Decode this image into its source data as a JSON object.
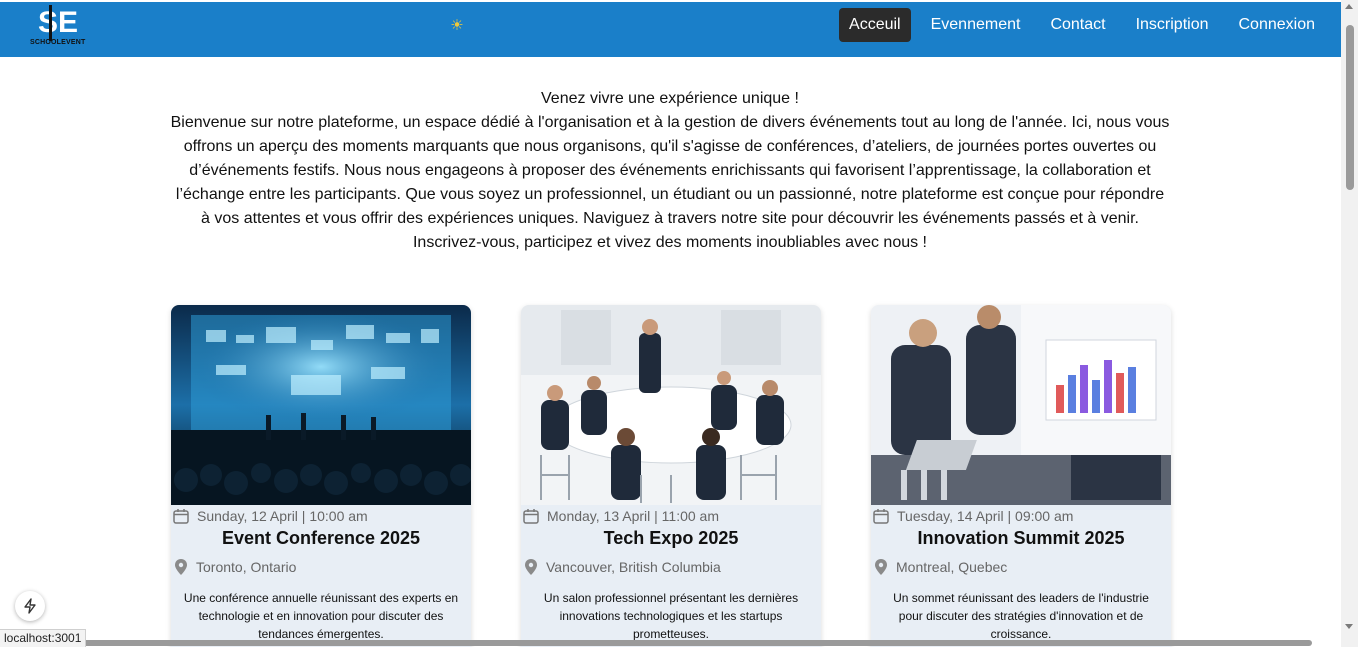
{
  "header": {
    "logo": {
      "initials": "SE",
      "name": "SCHOOLEVENT"
    },
    "theme_icon": "sun-icon",
    "nav": [
      {
        "label": "Acceuil",
        "active": true
      },
      {
        "label": "Evennement",
        "active": false
      },
      {
        "label": "Contact",
        "active": false
      },
      {
        "label": "Inscription",
        "active": false
      },
      {
        "label": "Connexion",
        "active": false
      }
    ]
  },
  "intro": {
    "headline": "Venez vivre une expérience unique !",
    "body": "Bienvenue sur notre plateforme, un espace dédié à l'organisation et à la gestion de divers événements tout au long de l'année. Ici, nous vous offrons un aperçu des moments marquants que nous organisons, qu'il s'agisse de conférences, d’ateliers, de journées portes ouvertes ou d’événements festifs. Nous nous engageons à proposer des événements enrichissants qui favorisent l’apprentissage, la collaboration et l’échange entre les participants. Que vous soyez un professionnel, un étudiant ou un passionné, notre plateforme est conçue pour répondre à vos attentes et vous offrir des expériences uniques. Naviguez à travers notre site pour découvrir les événements passés et à venir. Inscrivez-vous, participez et vivez des moments inoubliables avec nous !"
  },
  "events": [
    {
      "date": "Sunday, 12 April | 10:00 am",
      "title": "Event Conference 2025",
      "location": "Toronto, Ontario",
      "description": "Une conférence annuelle réunissant des experts en technologie et en innovation pour discuter des tendances émergentes."
    },
    {
      "date": "Monday, 13 April | 11:00 am",
      "title": "Tech Expo 2025",
      "location": "Vancouver, British Columbia",
      "description": "Un salon professionnel présentant les dernières innovations technologiques et les startups prometteuses."
    },
    {
      "date": "Tuesday, 14 April | 09:00 am",
      "title": "Innovation Summit 2025",
      "location": "Montreal, Quebec",
      "description": "Un sommet réunissant des leaders de l'industrie pour discuter des stratégies d'innovation et de croissance."
    }
  ],
  "status_bar": {
    "url": "localhost:3001"
  },
  "colors": {
    "header": "#1a7fc9",
    "active_nav": "#2b2b2b",
    "card_bg": "#e8eef5"
  }
}
